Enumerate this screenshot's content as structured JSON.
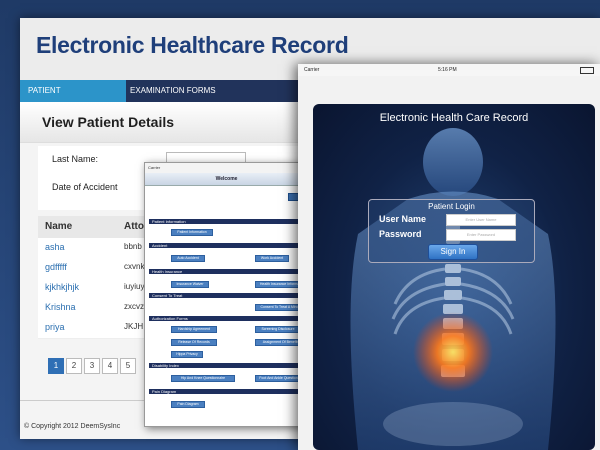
{
  "web": {
    "title": "Electronic Healthcare Record",
    "nav": [
      "PATIENT INFORMATION",
      "EXAMINATION FORMS"
    ],
    "subtitle": "View Patient Details",
    "form": {
      "last_name_label": "Last Name:",
      "date_accident_label": "Date of Accident"
    },
    "table": {
      "headers": [
        "Name",
        "Atto"
      ],
      "rows": [
        {
          "name": "asha",
          "att": "bbnb"
        },
        {
          "name": "gdfffff",
          "att": "cxvnk"
        },
        {
          "name": "kjkhkjhjk",
          "att": "iuyiuy"
        },
        {
          "name": "Krishna",
          "att": "zxcvz"
        },
        {
          "name": "priya",
          "att": "JKJH"
        }
      ]
    },
    "pager": [
      "1",
      "2",
      "3",
      "4",
      "5"
    ],
    "footer": "© Copyright 2012 DeemSysInc"
  },
  "tablet2": {
    "carrier": "Carrier",
    "title": "Welcome",
    "sections": [
      {
        "label": "Patient Information",
        "buttons": [
          "Patient Information"
        ]
      },
      {
        "label": "Accident",
        "buttons": [
          "Auto Accident",
          "Work Accident"
        ]
      },
      {
        "label": "Health Insurance",
        "buttons": [
          "Insurance Waiver",
          "Health Insurance Informa..."
        ]
      },
      {
        "label": "Consent To Treat",
        "buttons": [
          "Consent To Treat A Mino..."
        ]
      },
      {
        "label": "Authorization Forms",
        "buttons": [
          "Hardship Agreement",
          "Screening Disclosure",
          "Release Of Records",
          "Assignment Of Benefits",
          "Hippa Privacy"
        ]
      },
      {
        "label": "Disability Index",
        "buttons": [
          "Hip And Knee Questionnaire",
          "Foot And Ankle Questionn..."
        ]
      },
      {
        "label": "Pain Diagram",
        "buttons": [
          "Pain Diagram"
        ]
      }
    ]
  },
  "ipad": {
    "carrier": "Carrier",
    "time": "5:16 PM",
    "title": "Electronic Health Care Record",
    "login_title": "Patient Login",
    "username_label": "User Name",
    "username_placeholder": "Enter User Name",
    "password_label": "Password",
    "password_placeholder": "Enter Password",
    "signin": "Sign In"
  }
}
